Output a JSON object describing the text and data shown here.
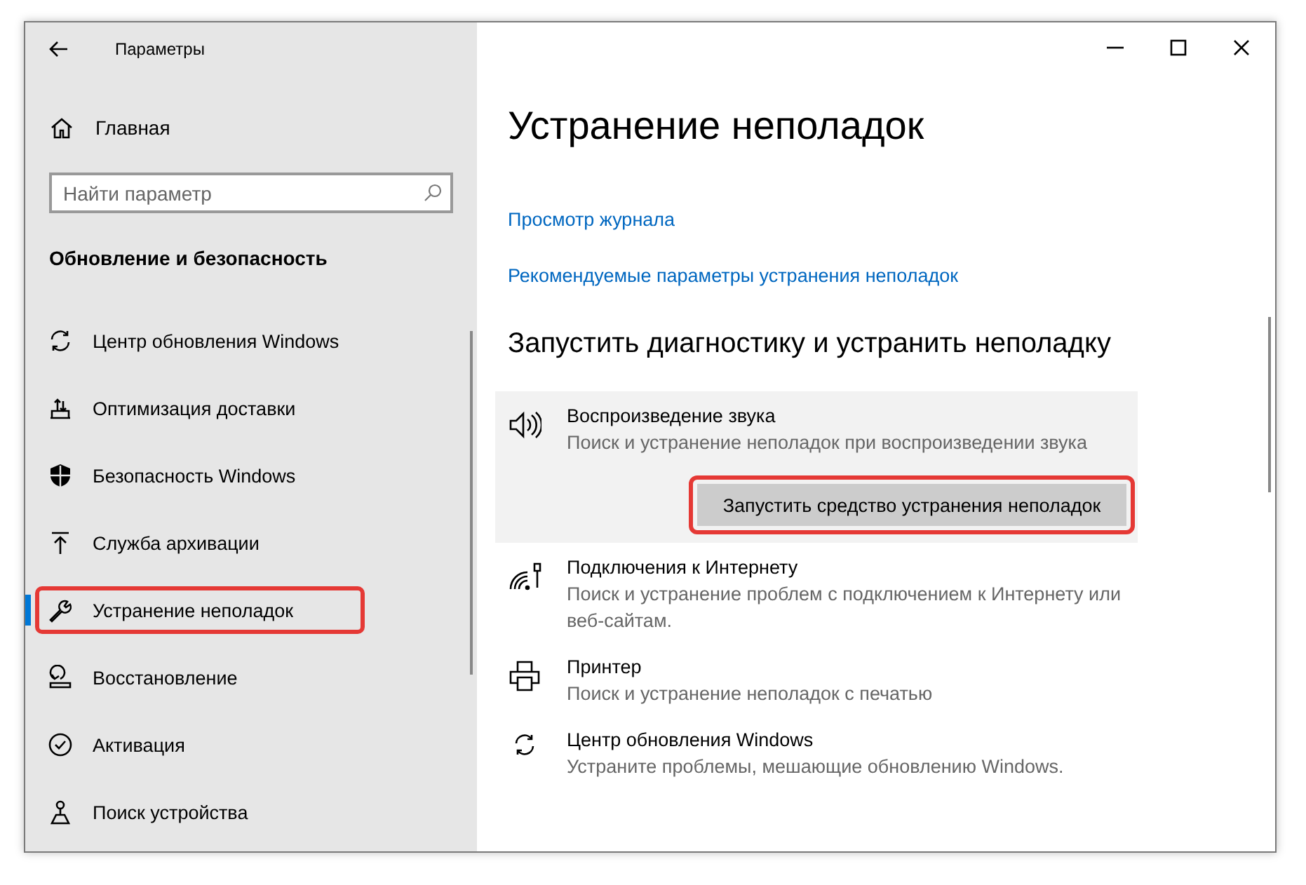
{
  "window": {
    "title": "Параметры"
  },
  "sidebar": {
    "home": "Главная",
    "search": {
      "placeholder": "Найти параметр"
    },
    "section": "Обновление и безопасность",
    "items": [
      {
        "label": "Центр обновления Windows",
        "selected": false,
        "highlighted": false
      },
      {
        "label": "Оптимизация доставки",
        "selected": false,
        "highlighted": false
      },
      {
        "label": "Безопасность Windows",
        "selected": false,
        "highlighted": false
      },
      {
        "label": "Служба архивации",
        "selected": false,
        "highlighted": false
      },
      {
        "label": "Устранение неполадок",
        "selected": true,
        "highlighted": true
      },
      {
        "label": "Восстановление",
        "selected": false,
        "highlighted": false
      },
      {
        "label": "Активация",
        "selected": false,
        "highlighted": false
      },
      {
        "label": "Поиск устройства",
        "selected": false,
        "highlighted": false
      }
    ]
  },
  "content": {
    "title": "Устранение неполадок",
    "links": [
      "Просмотр журнала",
      "Рекомендуемые параметры устранения неполадок"
    ],
    "section": "Запустить диагностику и устранить неполадку",
    "troubleshooters": [
      {
        "title": "Воспроизведение звука",
        "description": "Поиск и устранение неполадок при воспроизведении звука",
        "expanded": true,
        "button": {
          "label": "Запустить средство устранения неполадок",
          "highlighted": true
        }
      },
      {
        "title": "Подключения к Интернету",
        "description": "Поиск и устранение проблем с подключением к Интернету или веб-сайтам.",
        "expanded": false
      },
      {
        "title": "Принтер",
        "description": "Поиск и устранение неполадок с печатью",
        "expanded": false
      },
      {
        "title": "Центр обновления Windows",
        "description": "Устраните проблемы, мешающие обновлению Windows.",
        "expanded": false
      }
    ]
  }
}
